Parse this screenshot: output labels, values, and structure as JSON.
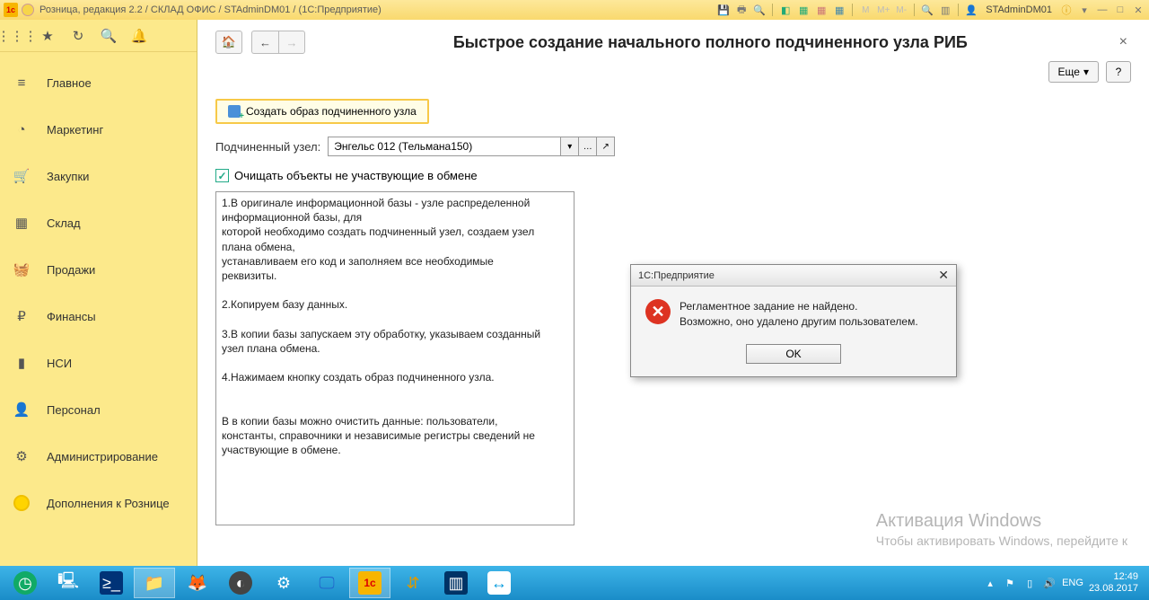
{
  "titlebar": {
    "text": "Розница, редакция 2.2 / СКЛАД ОФИС / STAdminDM01 / (1С:Предприятие)",
    "user": "STAdminDM01",
    "m1": "M",
    "m2": "M+",
    "m3": "M-"
  },
  "sidebar": {
    "items": [
      {
        "label": "Главное"
      },
      {
        "label": "Маркетинг"
      },
      {
        "label": "Закупки"
      },
      {
        "label": "Склад"
      },
      {
        "label": "Продажи"
      },
      {
        "label": "Финансы"
      },
      {
        "label": "НСИ"
      },
      {
        "label": "Персонал"
      },
      {
        "label": "Администрирование"
      },
      {
        "label": "Дополнения к Рознице"
      }
    ]
  },
  "page": {
    "title": "Быстрое создание начального полного подчиненного узла РИБ",
    "more": "Еще",
    "help": "?",
    "create_btn": "Создать образ подчиненного узла",
    "node_label": "Подчиненный узел:",
    "node_value": "Энгельс 012 (Тельмана150)",
    "cleanup": "Очищать объекты не участвующие в обмене",
    "instructions": "1.В оригинале информационной базы - узле распределенной информационной базы, для\nкоторой необходимо создать подчиненный узел, создаем узел\nплана обмена,\nустанавливаем его код и заполняем все необходимые\nреквизиты.\n\n2.Копируем базу данных.\n\n3.В копии базы запускаем эту обработку, указываем созданный\nузел плана обмена.\n\n4.Нажимаем кнопку создать образ подчиненного узла.\n\n\nВ в копии базы можно очистить данные: пользователи,\nконстанты, справочники и независимые регистры сведений не\nучаствующие в обмене."
  },
  "modal": {
    "title": "1С:Предприятие",
    "line1": "Регламентное задание не найдено.",
    "line2": "Возможно, оно удалено другим пользователем.",
    "ok": "OK"
  },
  "watermark": {
    "title": "Активация Windows",
    "sub": "Чтобы активировать Windows, перейдите к"
  },
  "tray": {
    "lang": "ENG",
    "time": "12:49",
    "date": "23.08.2017"
  }
}
